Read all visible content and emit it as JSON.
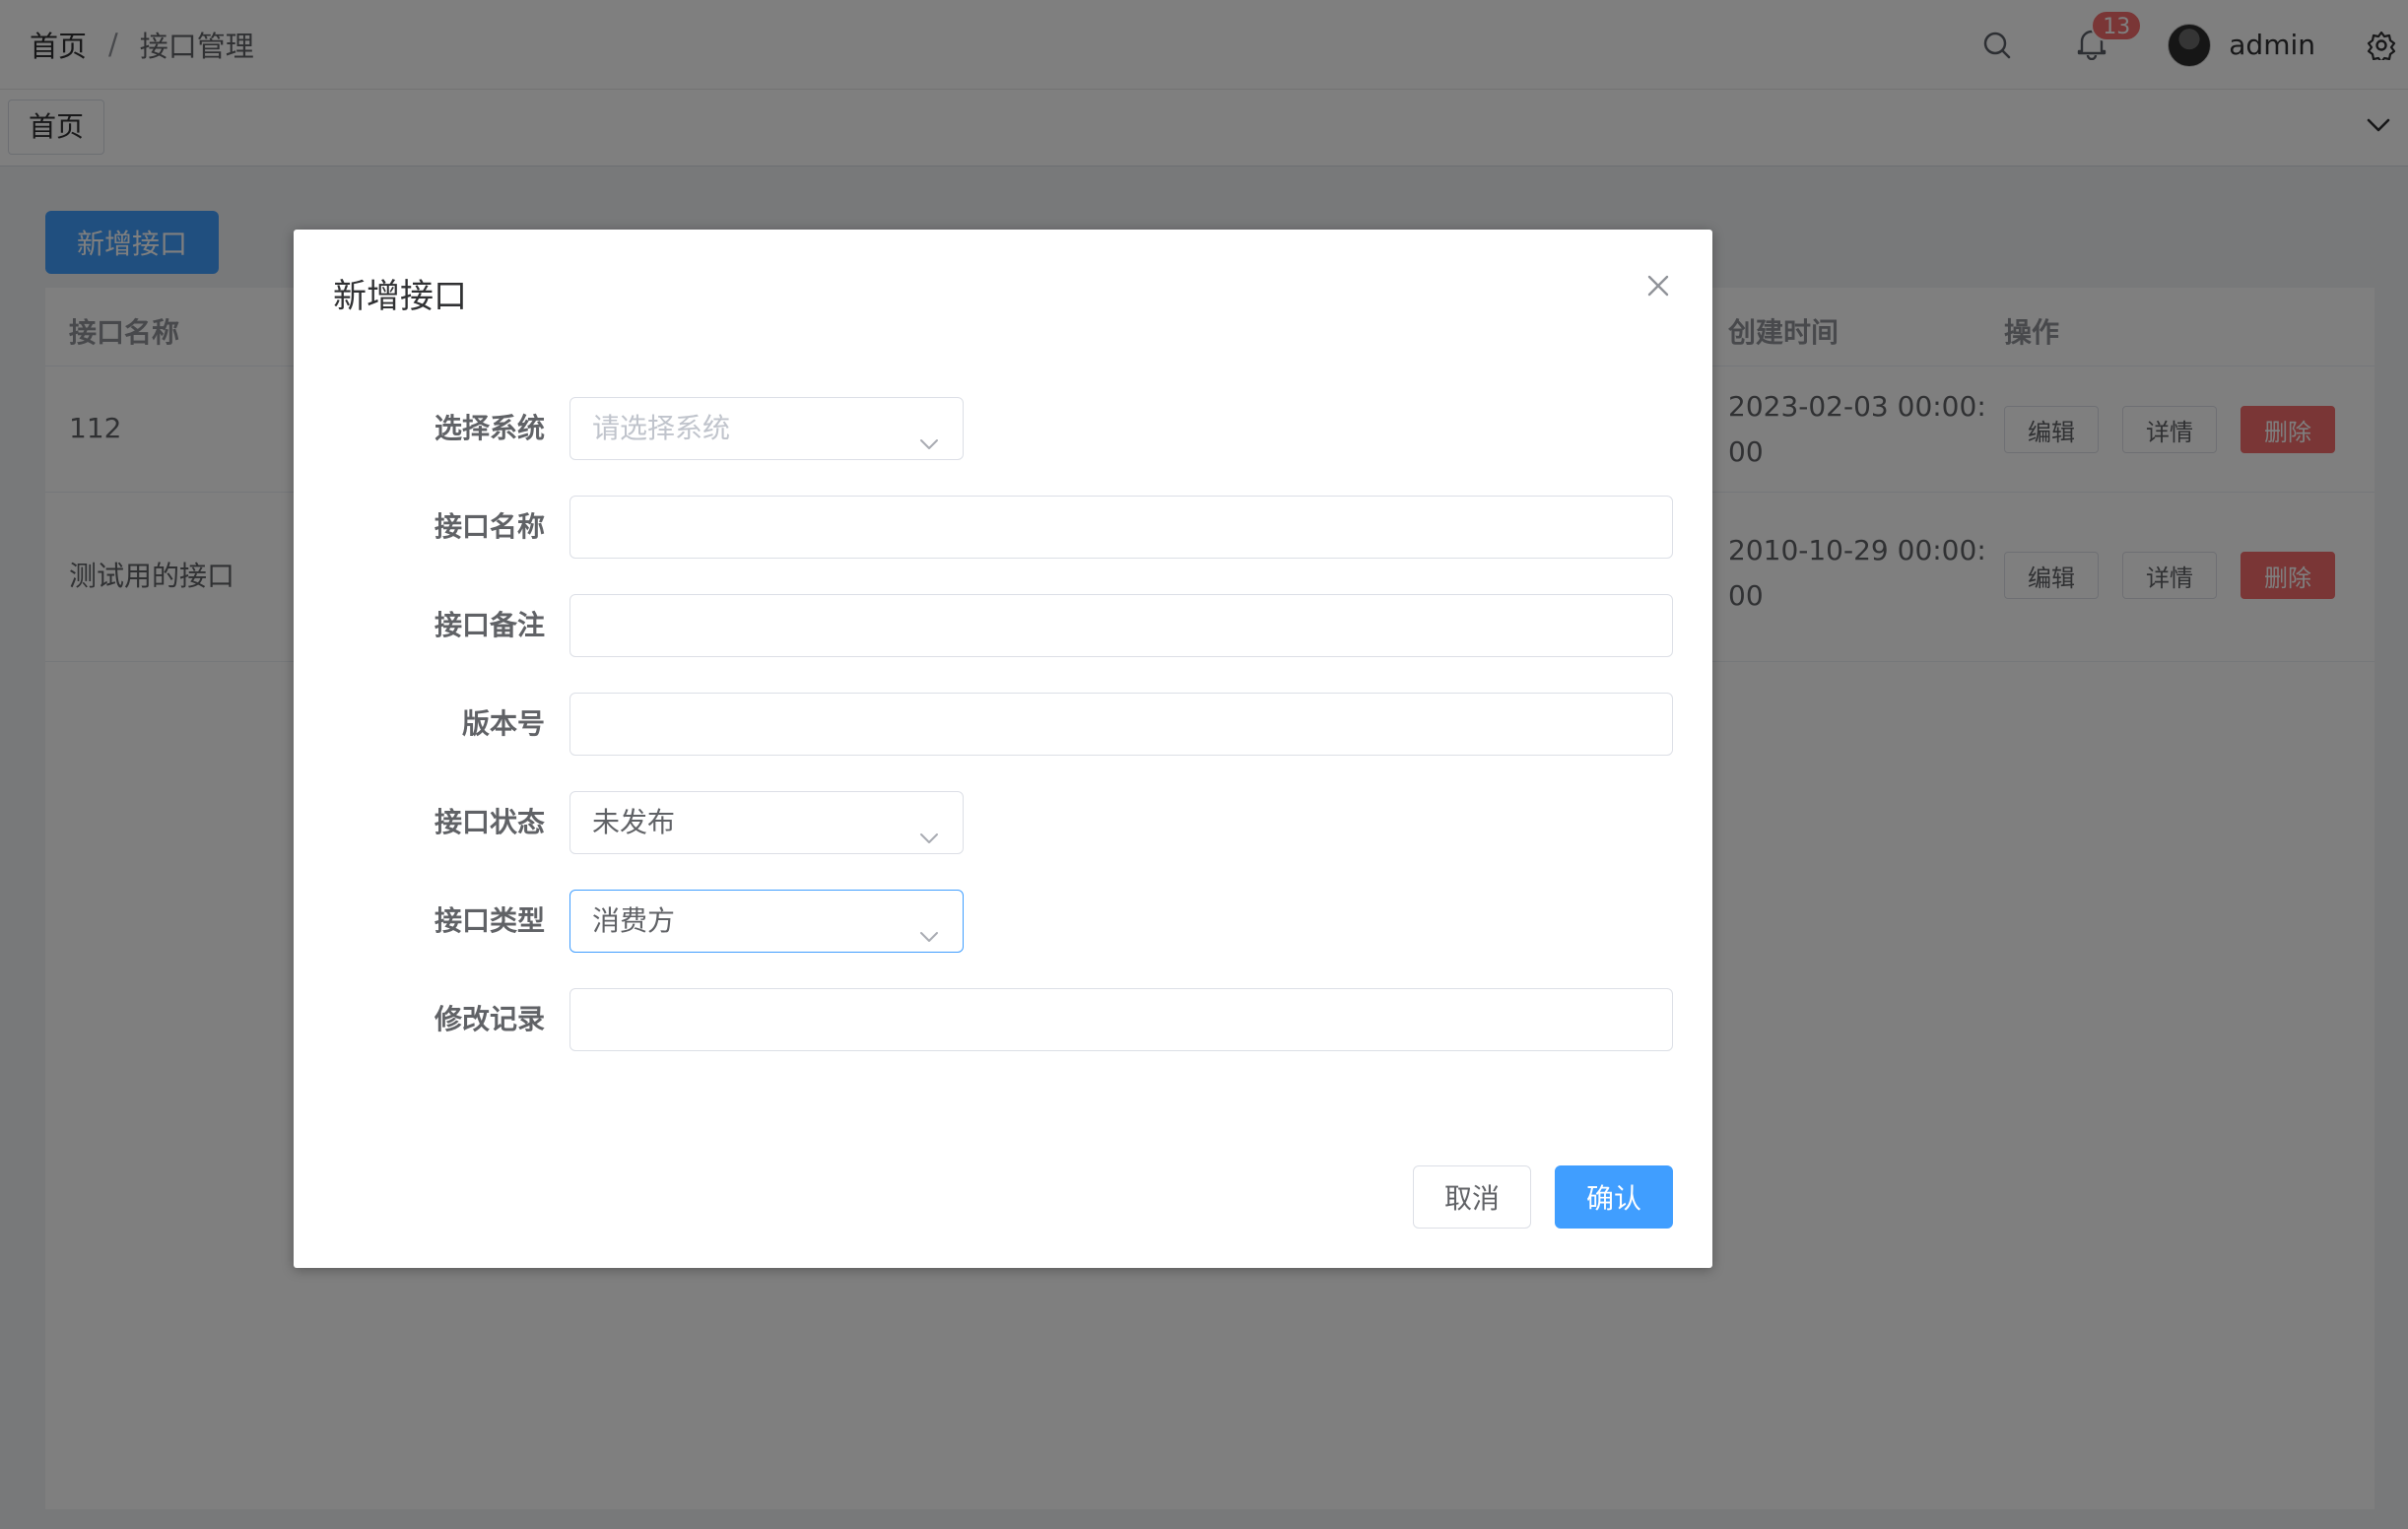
{
  "header": {
    "breadcrumb": [
      "首页",
      "接口管理"
    ],
    "separator": "/",
    "notification_count": "13",
    "username": "admin"
  },
  "tags": {
    "active": "首页"
  },
  "main": {
    "add_button": "新增接口",
    "table": {
      "columns": {
        "name": "接口名称",
        "created_at": "创建时间",
        "actions": "操作"
      },
      "rows": [
        {
          "name": "112",
          "created_line1": "2023-02-03 00:00:",
          "created_line2": "00"
        },
        {
          "name": "测试用的接口",
          "created_line1": "2010-10-29 00:00:",
          "created_line2": "00"
        }
      ],
      "actions": {
        "edit": "编辑",
        "detail": "详情",
        "delete": "删除"
      }
    }
  },
  "dialog": {
    "title": "新增接口",
    "fields": {
      "system": {
        "label": "选择系统",
        "placeholder": "请选择系统",
        "value": ""
      },
      "name": {
        "label": "接口名称",
        "value": ""
      },
      "remark": {
        "label": "接口备注",
        "value": ""
      },
      "version": {
        "label": "版本号",
        "value": ""
      },
      "status": {
        "label": "接口状态",
        "value": "未发布"
      },
      "type": {
        "label": "接口类型",
        "value": "消费方"
      },
      "history": {
        "label": "修改记录",
        "value": ""
      }
    },
    "cancel_label": "取消",
    "confirm_label": "确认"
  },
  "colors": {
    "primary": "#409eff",
    "danger": "#f56c6c",
    "overlay": "rgba(0,0,0,0.5)"
  },
  "icons": [
    "search-icon",
    "bell-icon",
    "gear-icon",
    "chevron-down-icon",
    "close-icon"
  ]
}
